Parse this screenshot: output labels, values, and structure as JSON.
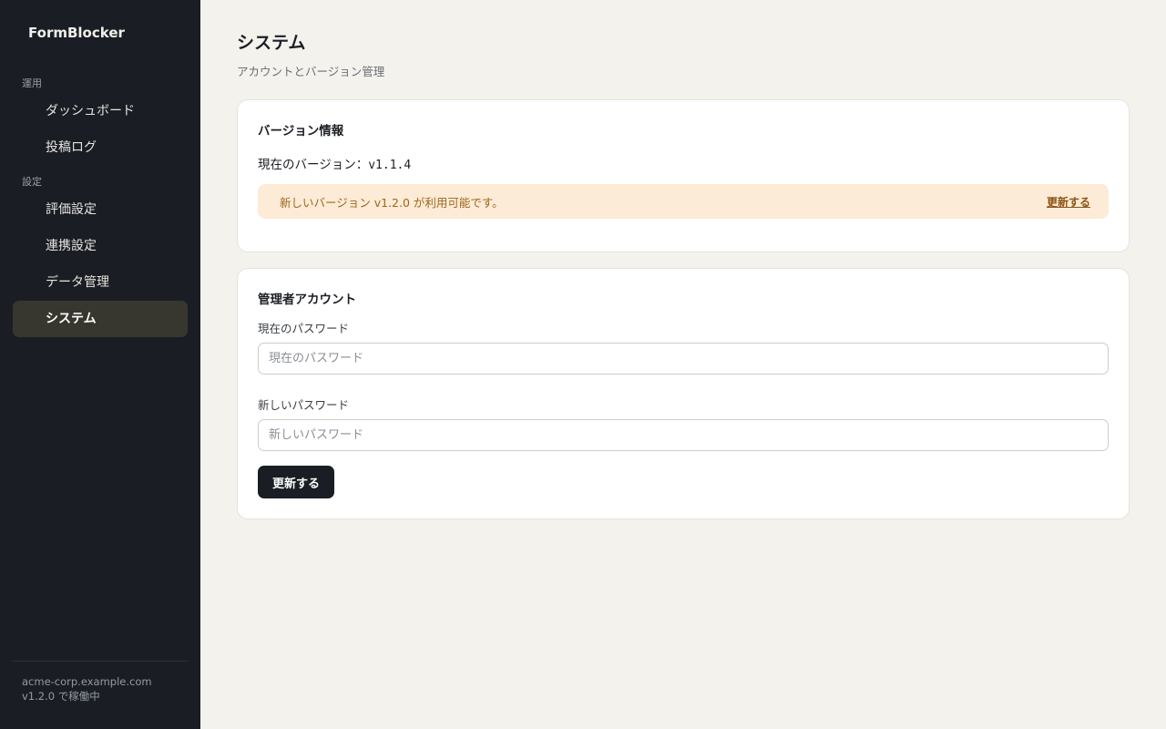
{
  "app": {
    "name": "FormBlocker"
  },
  "sidebar": {
    "groups": [
      {
        "label": "運用",
        "items": [
          {
            "label": "ダッシュボード"
          },
          {
            "label": "投稿ログ"
          }
        ]
      },
      {
        "label": "設定",
        "items": [
          {
            "label": "評価設定"
          },
          {
            "label": "連携設定"
          },
          {
            "label": "データ管理"
          },
          {
            "label": "システム",
            "active": true
          }
        ]
      }
    ],
    "footer": {
      "host": "acme-corp.example.com",
      "status": "v1.2.0 で稼働中"
    }
  },
  "page": {
    "title": "システム",
    "subtitle": "アカウントとバージョン管理"
  },
  "version_card": {
    "title": "バージョン情報",
    "current_label": "現在のバージョン：",
    "current_value": "v1.1.4",
    "notice_text": "新しいバージョン v1.2.0 が利用可能です。",
    "notice_link": "更新する"
  },
  "account_card": {
    "title": "管理者アカウント",
    "current_password": {
      "label": "現在のパスワード",
      "placeholder": "現在のパスワード",
      "value": ""
    },
    "new_password": {
      "label": "新しいパスワード",
      "placeholder": "新しいパスワード",
      "value": ""
    },
    "submit_label": "更新する"
  },
  "colors": {
    "sidebar_bg": "#1a1e24",
    "active_item_bg": "#38372f",
    "page_bg": "#f4f2ed",
    "notice_bg": "#fcebd6",
    "notice_text": "#a0651c",
    "primary_button": "#1a1e24"
  }
}
